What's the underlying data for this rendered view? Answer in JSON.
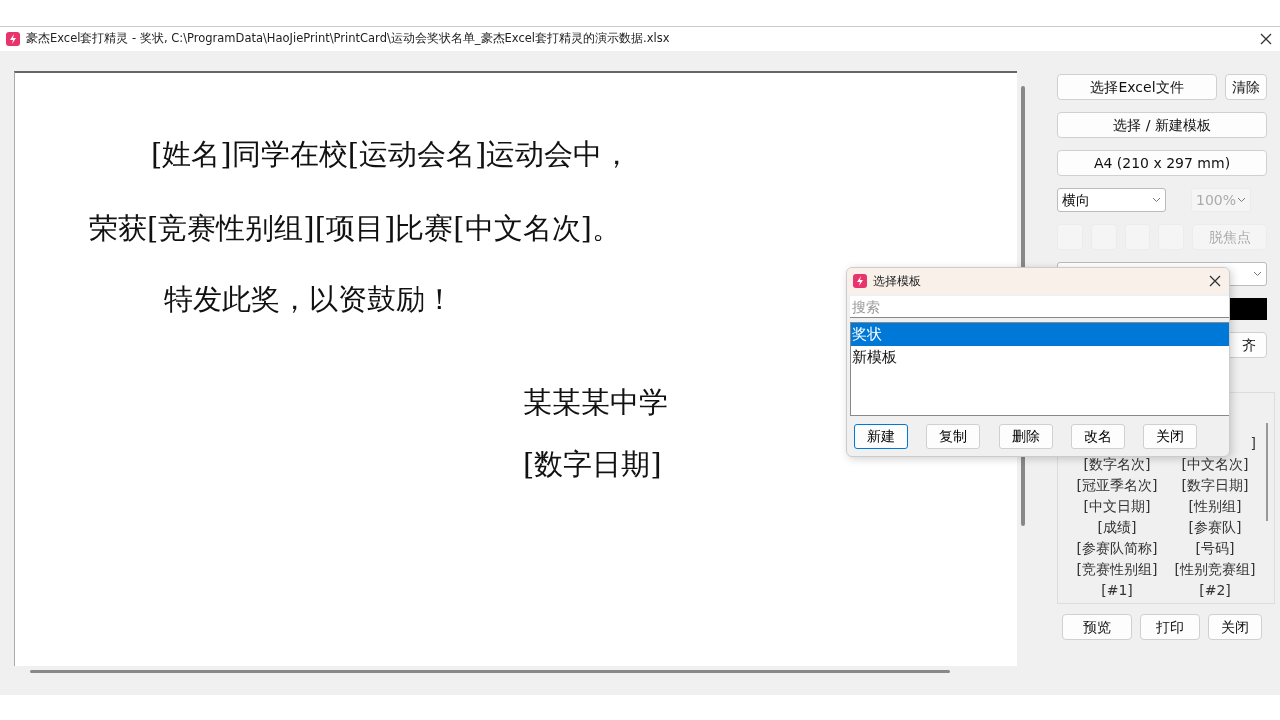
{
  "window": {
    "title": "豪杰Excel套打精灵 - 奖状, C:\\ProgramData\\HaoJiePrint\\PrintCard\\运动会奖状名单_豪杰Excel套打精灵的演示数据.xlsx"
  },
  "canvas": {
    "lines": [
      {
        "text": "[姓名]同学在校[运动会名]运动会中，"
      },
      {
        "text": "荣获[竞赛性别组][项目]比赛[中文名次]。"
      },
      {
        "text": "特发此奖，以资鼓励！"
      },
      {
        "text": "某某某中学"
      },
      {
        "text": "[数字日期]"
      }
    ]
  },
  "side_panel": {
    "file_button": "选择Excel文件",
    "clear_button": "清除",
    "template_button": "选择 / 新建模板",
    "paper_size_button": "A4 (210 x 297 mm)",
    "orientation_select": {
      "value": "横向",
      "disabled": false
    },
    "zoom_select": {
      "value": "100%",
      "disabled": true
    },
    "tool_buttons": [
      {
        "disabled": true
      },
      {
        "disabled": true
      },
      {
        "disabled": true
      },
      {
        "disabled": true
      }
    ],
    "defocus_button": {
      "label": "脱焦点",
      "disabled": true
    },
    "align_button": {
      "label": "齐"
    },
    "field_tags": [
      {
        "right": "]"
      },
      {
        "left": "[数字名次]",
        "right": "[中文名次]"
      },
      {
        "left": "[冠亚季名次]",
        "right": "[数字日期]"
      },
      {
        "left": "[中文日期]",
        "right": "[性别组]"
      },
      {
        "left": "[成绩]",
        "right": "[参赛队]"
      },
      {
        "left": "[参赛队简称]",
        "right": "[号码]"
      },
      {
        "left": "[竞赛性别组]",
        "right": "[性别竞赛组]"
      },
      {
        "left": "[#1]",
        "right": "[#2]"
      }
    ],
    "actions": [
      "预览",
      "打印",
      "关闭"
    ]
  },
  "dialog": {
    "title": "选择模板",
    "search": {
      "placeholder": "搜索"
    },
    "templates": [
      {
        "label": "奖状",
        "selected": true
      },
      {
        "label": "新模板",
        "selected": false
      }
    ],
    "buttons": [
      {
        "label": "新建",
        "focused": true
      },
      {
        "label": "复制",
        "focused": false
      },
      {
        "label": "删除",
        "focused": false
      },
      {
        "label": "改名",
        "focused": false
      },
      {
        "label": "关闭",
        "focused": false
      }
    ]
  }
}
